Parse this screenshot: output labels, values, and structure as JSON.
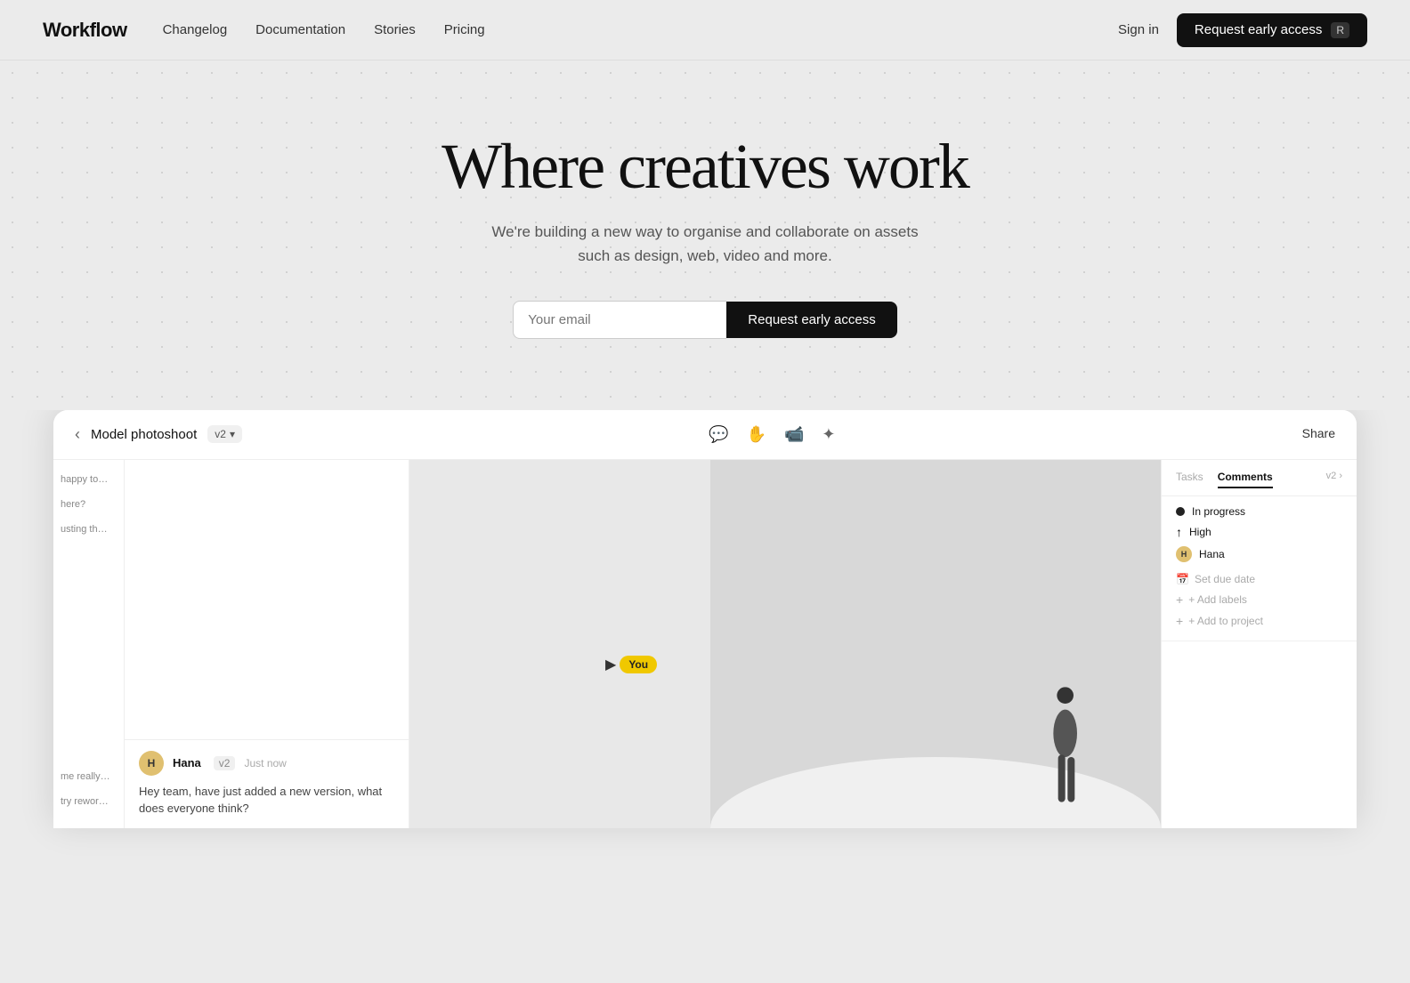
{
  "nav": {
    "logo": "Workflow",
    "links": [
      {
        "label": "Changelog",
        "id": "changelog"
      },
      {
        "label": "Documentation",
        "id": "documentation"
      },
      {
        "label": "Stories",
        "id": "stories"
      },
      {
        "label": "Pricing",
        "id": "pricing"
      }
    ],
    "signin": "Sign in",
    "cta_label": "Request early access",
    "cta_kbd": "R"
  },
  "hero": {
    "title": "Where creatives work",
    "subtitle": "We're building a new way to organise and collaborate on assets such as design, web, video and more.",
    "email_placeholder": "Your email",
    "cta_label": "Request early access"
  },
  "app": {
    "back_icon": "‹",
    "title": "Model photoshoot",
    "version": "v2",
    "share_label": "Share",
    "icons": [
      "comment",
      "hand",
      "video",
      "sparkle"
    ],
    "right_panel": {
      "tasks_tab": "Tasks",
      "comments_tab": "Comments",
      "version_label": "v2 ›",
      "status_label": "In progress",
      "priority_label": "High",
      "assignee": "Hana",
      "due_date": "Set due date",
      "add_labels": "+ Add labels",
      "add_project": "+ Add to project"
    },
    "chat": {
      "avatar_initials": "H",
      "user_name": "Hana",
      "version": "v2",
      "time": "Just now",
      "message": "Hey team, have just added a new version, what does everyone think?"
    },
    "left_comments": [
      "happy to c...",
      "here?",
      "usting the s...",
      "me really ...",
      "try reword..."
    ],
    "cursor_label": "You"
  }
}
